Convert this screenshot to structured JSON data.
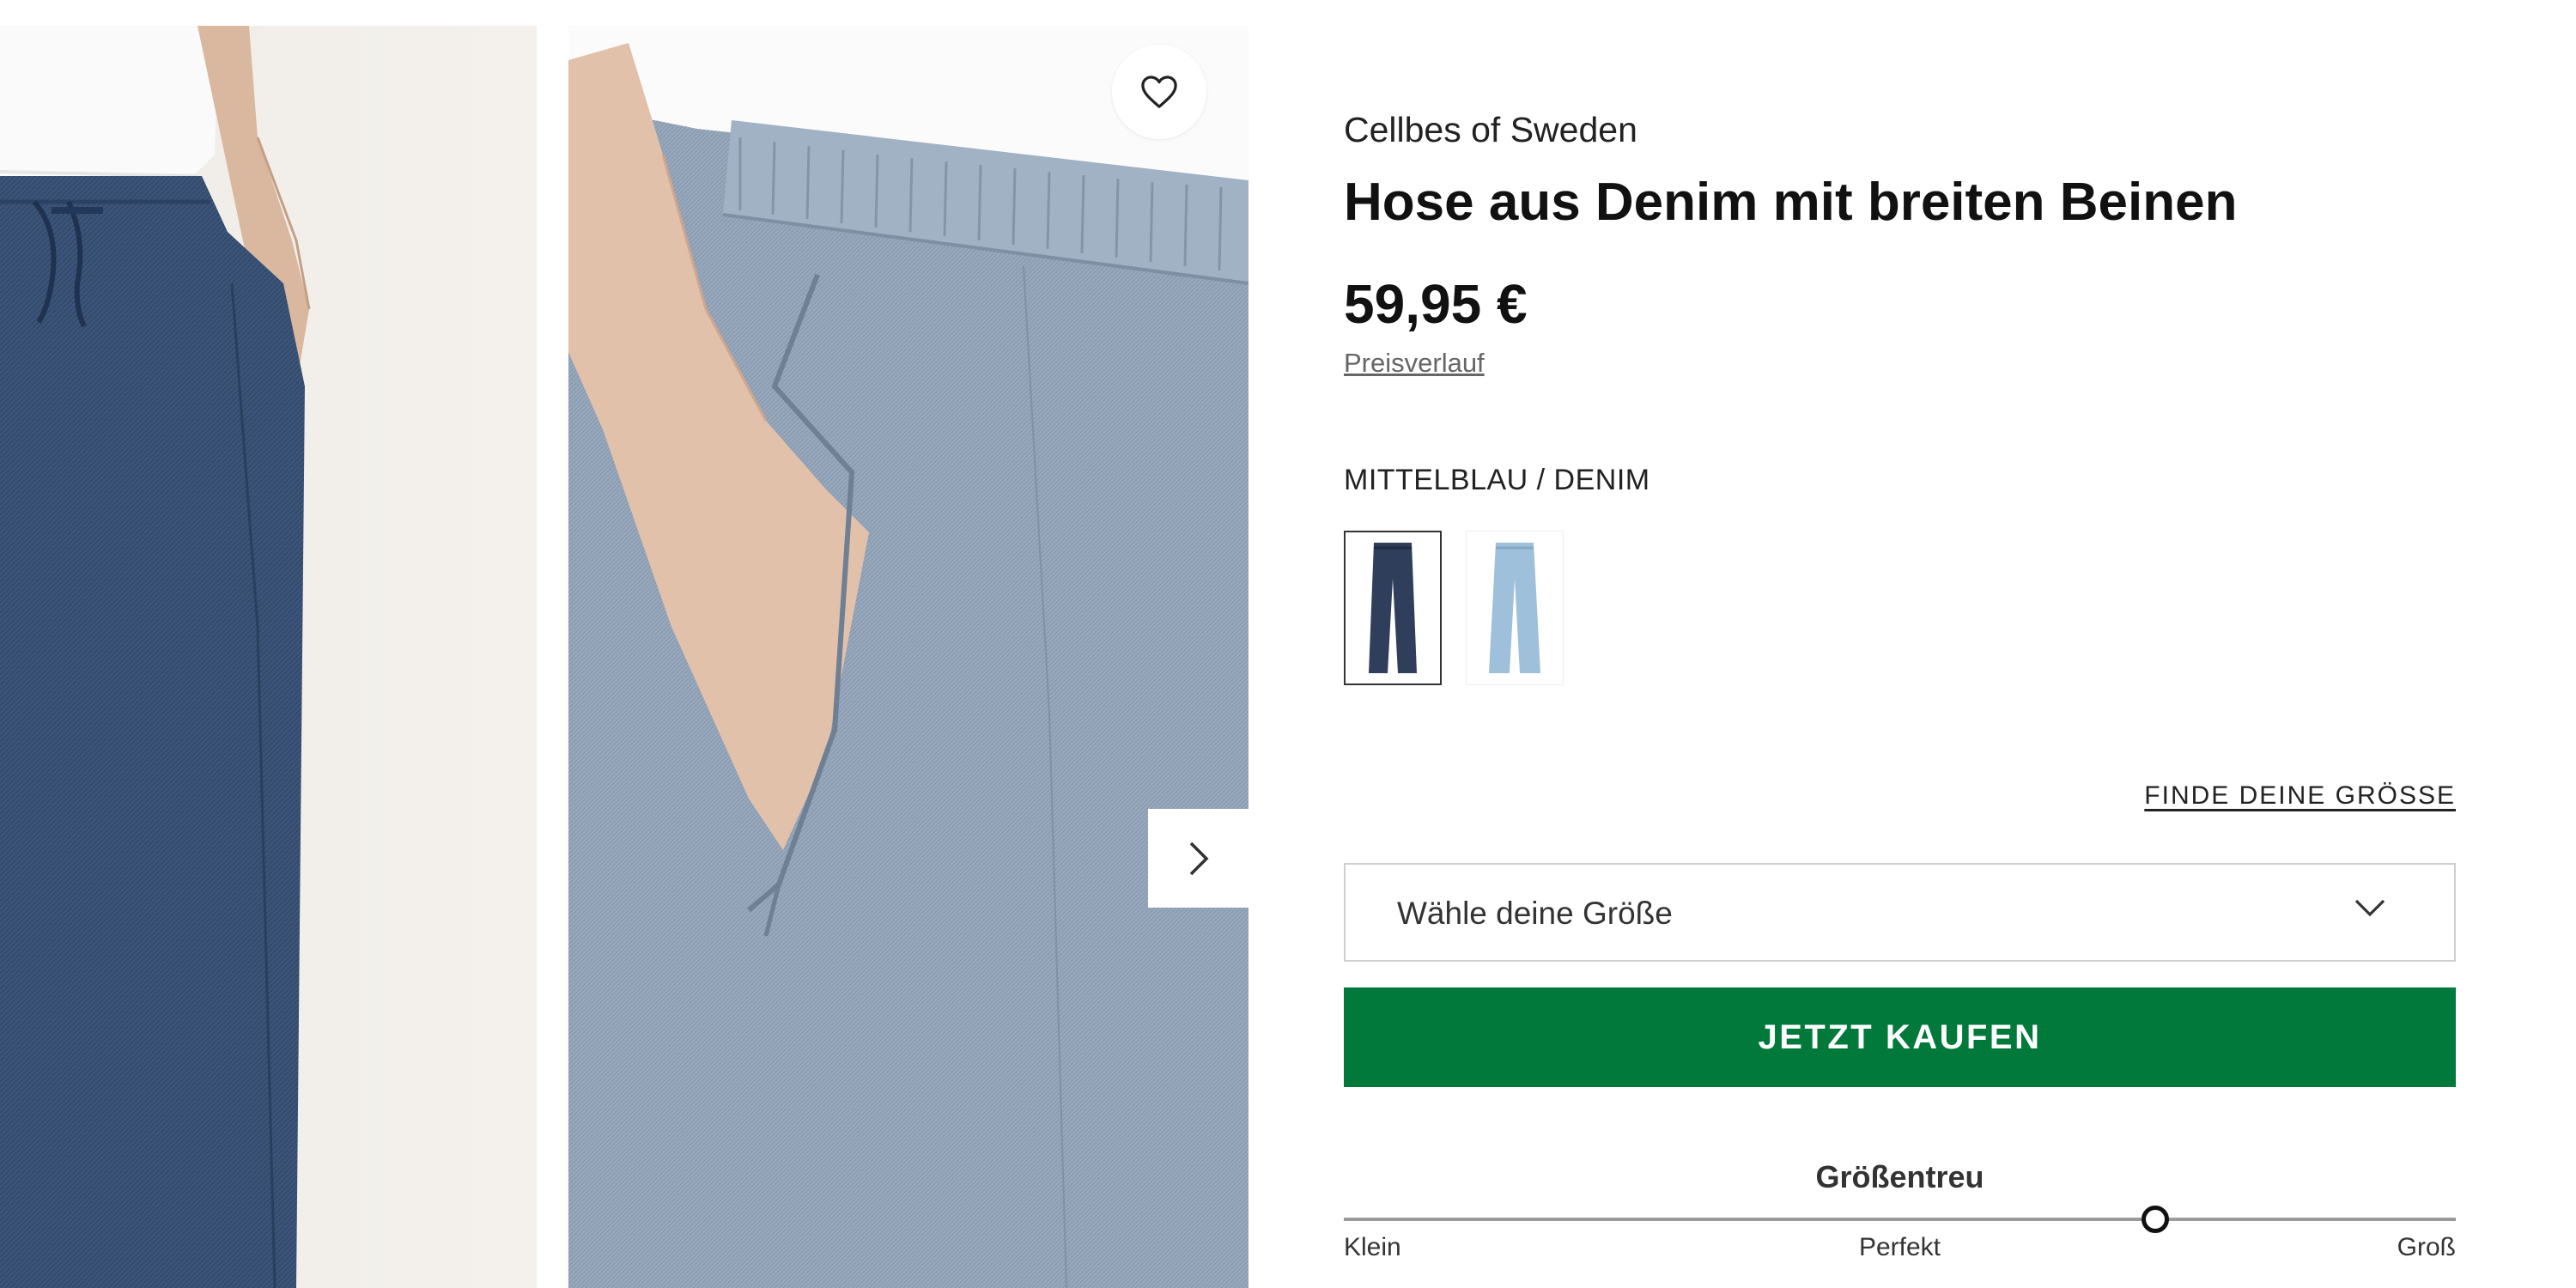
{
  "product": {
    "brand": "Cellbes of Sweden",
    "title": "Hose aus Denim mit breiten Beinen",
    "price": "59,95 €",
    "price_history_link": "Preisverlauf",
    "color_label": "MITTELBLAU / DENIM",
    "swatches": [
      {
        "name": "Mittelblau / Denim",
        "color": "#2f3e5a",
        "selected": true
      },
      {
        "name": "Hellblau",
        "color": "#9ec0da",
        "selected": false
      }
    ]
  },
  "size": {
    "find_size_link": "FINDE DEINE GRÖSSE",
    "select_placeholder": "Wähle deine Größe"
  },
  "buy_button_label": "JETZT KAUFEN",
  "fit": {
    "title": "Größentreu",
    "labels": [
      "Klein",
      "Perfekt",
      "Groß"
    ],
    "level": 0.73
  },
  "gallery": {
    "icons": [
      "heart-icon",
      "chevron-right-icon"
    ]
  },
  "colors": {
    "buy_button": "#00793a",
    "denim_dark": "#3a5275",
    "denim_light": "#95a6ba"
  }
}
